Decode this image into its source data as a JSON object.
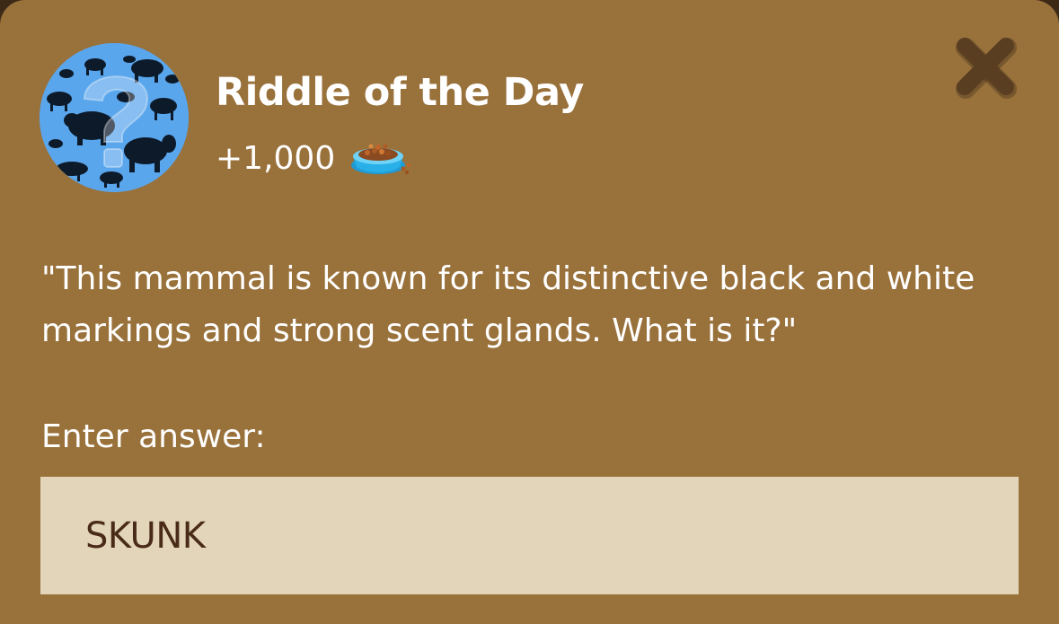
{
  "dialog": {
    "title": "Riddle of the Day",
    "reward_amount": "+1,000",
    "reward_icon": "pet-food-bowl-icon",
    "badge_icon": "animal-question-mark-icon",
    "close_icon": "close-icon"
  },
  "riddle": {
    "text": "\"This mammal is known for its distinctive black and white markings and strong scent glands. What is it?\""
  },
  "answer": {
    "label": "Enter answer:",
    "value": "SKUNK"
  },
  "colors": {
    "panel": "#99713b",
    "badge_blue": "#5aa6ec",
    "input_background": "#e2d5b9",
    "input_text": "#4a2a18",
    "close_icon": "#5a3e22"
  }
}
